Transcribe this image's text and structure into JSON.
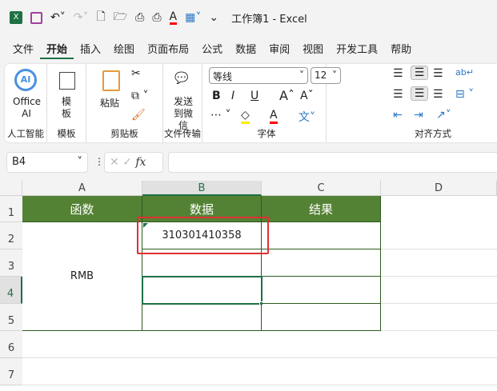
{
  "title_bar": {
    "title": "工作簿1 - Excel"
  },
  "tabs": [
    "文件",
    "开始",
    "插入",
    "绘图",
    "页面布局",
    "公式",
    "数据",
    "审阅",
    "视图",
    "开发工具",
    "帮助"
  ],
  "ribbon": {
    "ai": {
      "button": "Office AI",
      "label": "人工智能"
    },
    "template": {
      "button": "模板",
      "label": "模板"
    },
    "clipboard": {
      "paste": "粘贴",
      "label": "剪贴板"
    },
    "transfer": {
      "button": "发送到微信",
      "label": "文件传输"
    },
    "font": {
      "name": "等线",
      "size": "12",
      "bold": "B",
      "italic": "I",
      "underline": "U",
      "label": "字体"
    },
    "align": {
      "label": "对齐方式"
    }
  },
  "formula_bar": {
    "name_box": "B4",
    "fx": "fx",
    "value": ""
  },
  "columns": [
    "A",
    "B",
    "C",
    "D"
  ],
  "rows": [
    "1",
    "2",
    "3",
    "4",
    "5",
    "6",
    "7"
  ],
  "cells": {
    "A1": "函数",
    "B1": "数据",
    "C1": "结果",
    "A2": "RMB",
    "B2": "310301410358"
  },
  "colors": {
    "header_fill": "#548235",
    "accent": "#1e7145",
    "highlight": "#e03030"
  }
}
